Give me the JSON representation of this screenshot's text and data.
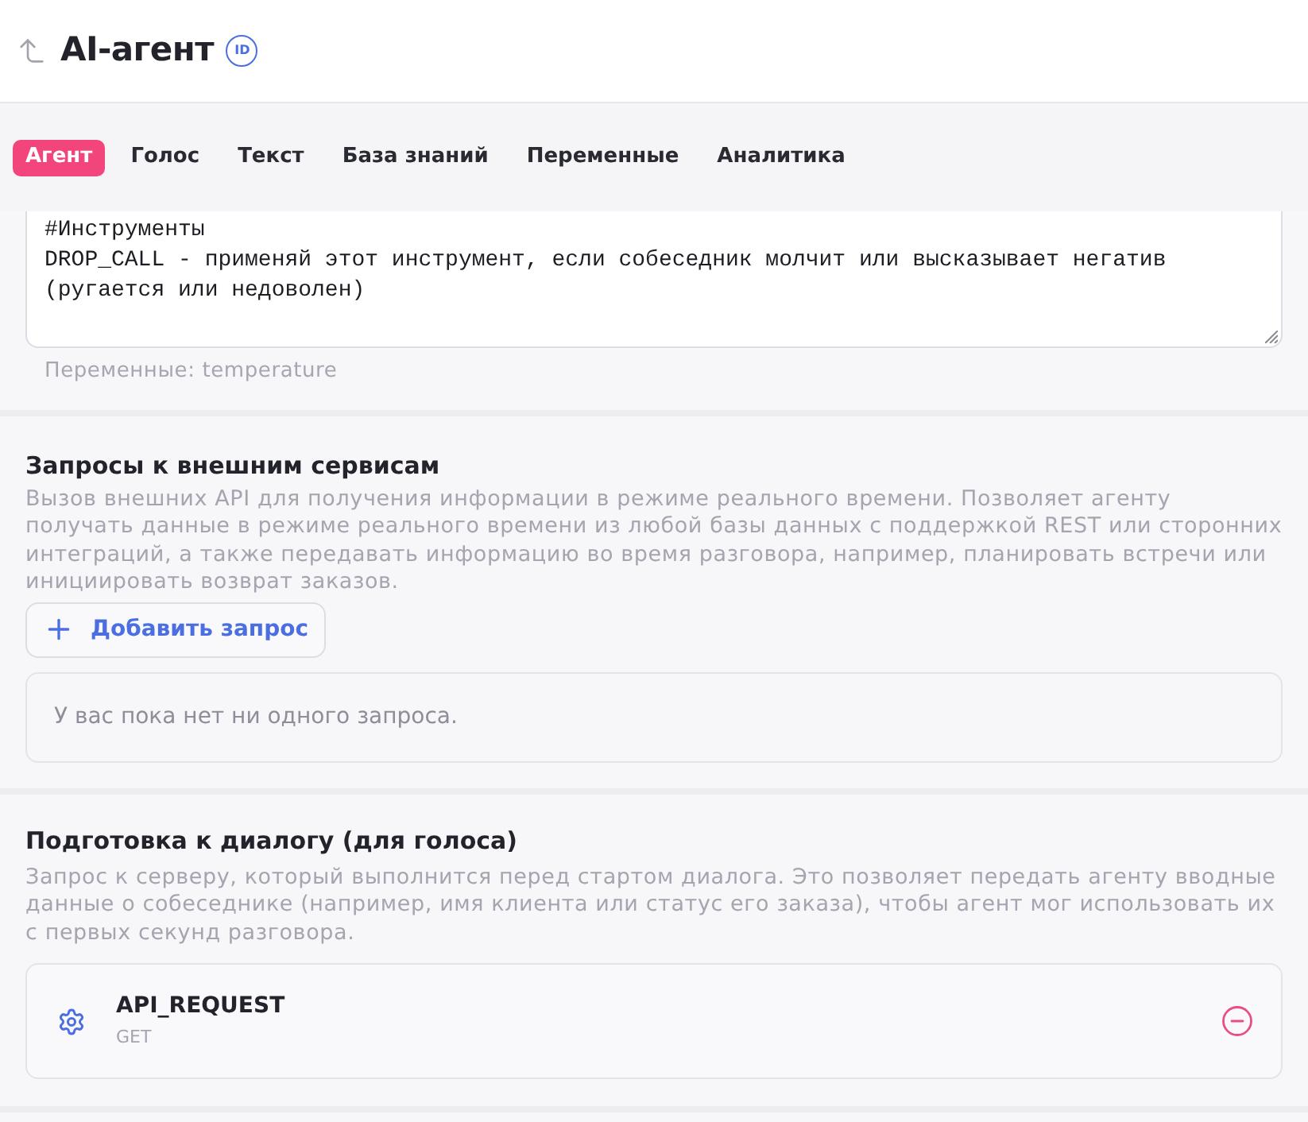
{
  "header": {
    "title": "AI-агент",
    "id_badge": "ID"
  },
  "tabs": [
    {
      "label": "Агент",
      "selected": true
    },
    {
      "label": "Голос",
      "selected": false
    },
    {
      "label": "Текст",
      "selected": false
    },
    {
      "label": "База знаний",
      "selected": false
    },
    {
      "label": "Переменные",
      "selected": false
    },
    {
      "label": "Аналитика",
      "selected": false
    }
  ],
  "prompt": {
    "value": "#Инструменты\nDROP_CALL - применяй этот инструмент, если собеседник молчит или высказывает негатив (ругается или недоволен)",
    "variables_hint": "Переменные: temperature"
  },
  "external_requests": {
    "title": "Запросы к внешним сервисам",
    "description": "Вызов внешних API для получения информации в режиме реального времени. Позволяет агенту получать данные в режиме реального времени из любой базы данных с поддержкой REST или сторонних интеграций, а также передавать информацию во время разговора, например, планировать встречи или инициировать возврат заказов.",
    "add_button": "Добавить запрос",
    "empty_text": "У вас пока нет ни одного запроса."
  },
  "dialog_preparation": {
    "title": "Подготовка к диалогу (для голоса)",
    "description": "Запрос к серверу, который выполнится перед стартом диалога. Это позволяет передать агенту вводные данные о собеседнике (например, имя клиента или статус его заказа), чтобы агент мог использовать их с первых секунд разговора.",
    "requests": [
      {
        "name": "API_REQUEST",
        "method": "GET"
      }
    ]
  }
}
